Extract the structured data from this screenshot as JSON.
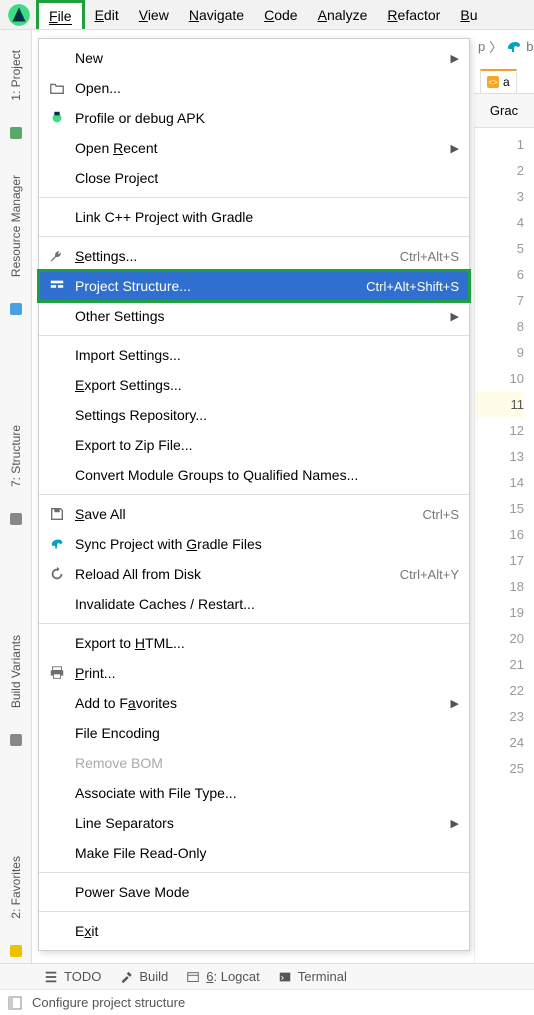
{
  "menubar": {
    "items": [
      "File",
      "Edit",
      "View",
      "Navigate",
      "Code",
      "Analyze",
      "Refactor",
      "Bu"
    ]
  },
  "left_tools": [
    {
      "label": "1: Project"
    },
    {
      "label": "Resource Manager"
    },
    {
      "label": "7: Structure"
    },
    {
      "label": "Build Variants"
    },
    {
      "label": "2: Favorites"
    }
  ],
  "breadcrumb": {
    "tail": "p",
    "file_hint": "b"
  },
  "open_tab": {
    "label": "a"
  },
  "column_header": "Grac",
  "line_count": 25,
  "line_highlight": 11,
  "menu": {
    "groups": [
      [
        {
          "label": "New",
          "submenu": true
        },
        {
          "label": "Open...",
          "icon": "folder-open-icon"
        },
        {
          "label": "Profile or debug APK",
          "icon": "apk-debug-icon"
        },
        {
          "label": "Open Recent",
          "submenu": true,
          "ukey": "R",
          "pre": "Open "
        },
        {
          "label": "Close Project"
        }
      ],
      [
        {
          "label": "Link C++ Project with Gradle"
        }
      ],
      [
        {
          "label": "Settings...",
          "icon": "wrench-icon",
          "shortcut": "Ctrl+Alt+S",
          "ukey": "S"
        },
        {
          "label": "Project Structure...",
          "icon": "project-structure-icon",
          "shortcut": "Ctrl+Alt+Shift+S",
          "selected": true,
          "highlight": true
        },
        {
          "label": "Other Settings",
          "submenu": true
        }
      ],
      [
        {
          "label": "Import Settings..."
        },
        {
          "label": "Export Settings...",
          "ukey": "E"
        },
        {
          "label": "Settings Repository..."
        },
        {
          "label": "Export to Zip File..."
        },
        {
          "label": "Convert Module Groups to Qualified Names..."
        }
      ],
      [
        {
          "label": "Save All",
          "icon": "save-icon",
          "shortcut": "Ctrl+S",
          "ukey": "S"
        },
        {
          "label": "Sync Project with Gradle Files",
          "icon": "sync-gradle-icon",
          "ukey": "G",
          "pre": "Sync Project with "
        },
        {
          "label": "Reload All from Disk",
          "icon": "reload-icon",
          "shortcut": "Ctrl+Alt+Y"
        },
        {
          "label": "Invalidate Caches / Restart..."
        }
      ],
      [
        {
          "label": "Export to HTML...",
          "ukey": "H",
          "pre": "Export to "
        },
        {
          "label": "Print...",
          "icon": "print-icon",
          "ukey": "P"
        },
        {
          "label": "Add to Favorites",
          "submenu": true,
          "ukey": "a",
          "pre": "Add to F"
        },
        {
          "label": "File Encoding"
        },
        {
          "label": "Remove BOM",
          "disabled": true
        },
        {
          "label": "Associate with File Type..."
        },
        {
          "label": "Line Separators",
          "submenu": true
        },
        {
          "label": "Make File Read-Only"
        }
      ],
      [
        {
          "label": "Power Save Mode"
        }
      ],
      [
        {
          "label": "Exit",
          "ukey": "x",
          "pre": "E"
        }
      ]
    ]
  },
  "bottom": {
    "items": [
      {
        "label": "TODO",
        "icon": "todo-icon"
      },
      {
        "label": "Build",
        "icon": "hammer-icon"
      },
      {
        "label": "6: Logcat",
        "icon": "logcat-icon",
        "ukey": "6"
      },
      {
        "label": "Terminal",
        "icon": "terminal-icon"
      }
    ]
  },
  "status": {
    "icon": "window-icon",
    "text": "Configure project structure"
  }
}
